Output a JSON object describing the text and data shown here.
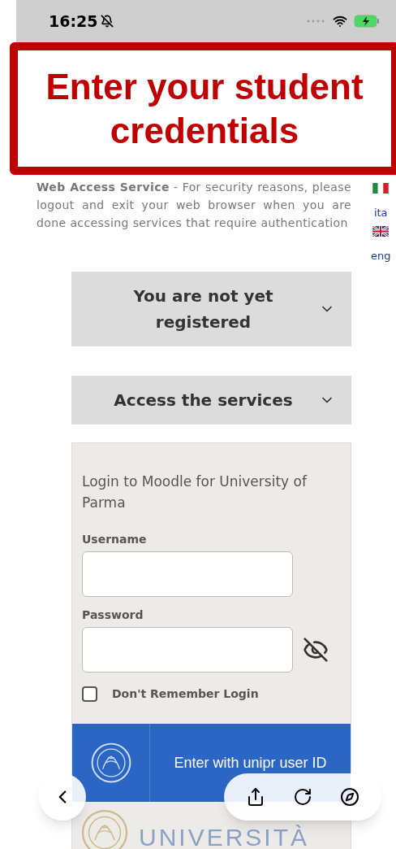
{
  "status_bar": {
    "time": "16:25",
    "silent": true
  },
  "callout": {
    "text": "Enter your student credentials"
  },
  "notice": {
    "text": "**Web Access Service** - For security reasons, please logout and exit your web browser when you are done accessing services that require authentication"
  },
  "languages": [
    {
      "label": "ita",
      "kind": "it"
    },
    {
      "label": "eng",
      "kind": "gb"
    }
  ],
  "sections": [
    {
      "title": "You are not yet registered",
      "expanded": false
    },
    {
      "title": "Access the services",
      "expanded": false
    }
  ],
  "login": {
    "heading": "Login to Moodle for University of Parma",
    "username_label": "Username",
    "password_label": "Password",
    "remember": {
      "label": "Don't Remember Login",
      "checked": false
    },
    "sso_button": "Enter with unipr user ID",
    "footer_logo_text": "UNIVERSITÀ"
  }
}
